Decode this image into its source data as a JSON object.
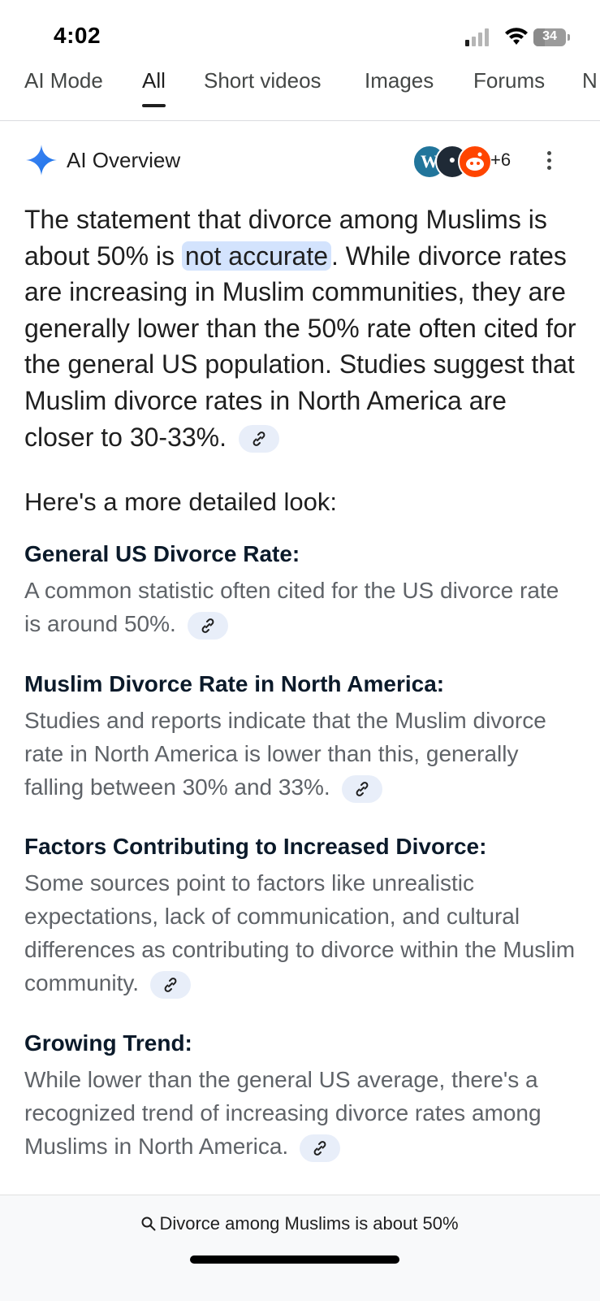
{
  "status_bar": {
    "time": "4:02",
    "battery": "34",
    "battery_level": 0.34
  },
  "tabs": [
    {
      "label": "AI Mode"
    },
    {
      "label": "All"
    },
    {
      "label": "Short videos"
    },
    {
      "label": "Images"
    },
    {
      "label": "Forums"
    },
    {
      "label": "N"
    }
  ],
  "active_tab": "All",
  "overview": {
    "title": "AI Overview",
    "source_count": "+6",
    "lead_pre": "The statement that divorce among Muslims is about 50% is",
    "lead_highlight": "not accurate",
    "lead_post": ". While divorce rates are increasing in Muslim communities, they are generally lower than the 50% rate often cited for the general US population. Studies suggest that Muslim divorce rates in North America are closer to 30-33%.",
    "detail_heading": "Here's a more detailed look:",
    "sections": [
      {
        "title": "General US Divorce Rate:",
        "body": "A common statistic often cited for the US divorce rate is around 50%."
      },
      {
        "title": "Muslim Divorce Rate in North America:",
        "body": "Studies and reports indicate that the Muslim divorce rate in North America is lower than this, generally falling between 30% and 33%."
      },
      {
        "title": "Factors Contributing to Increased Divorce:",
        "body": "Some sources point to factors like unrealistic expectations, lack of communication, and cultural differences as contributing to divorce within the Muslim community."
      },
      {
        "title": "Growing Trend:",
        "body": "While lower than the general US average, there's a recognized trend of increasing divorce rates among Muslims in North America."
      }
    ]
  },
  "bottom_bar": {
    "query": "Divorce among Muslims is about 50%"
  },
  "icons": {
    "ai": "sparkle-icon",
    "sources": [
      "wordpress-icon",
      "site-icon",
      "reddit-icon"
    ],
    "link": "link-icon",
    "more": "more-vert-icon",
    "search": "search-icon"
  },
  "colors": {
    "highlight": "#d3e3fd",
    "link_chip": "#e8eef9",
    "sparkle": "#4285f4"
  }
}
